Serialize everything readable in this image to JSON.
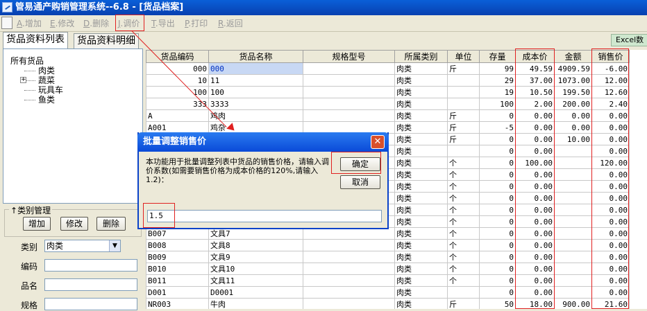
{
  "window": {
    "title": "管易通产购销管理系统--6.8 - [货品档案]"
  },
  "toolbar": {
    "items": [
      {
        "key": "A",
        "label": "增加"
      },
      {
        "key": "E",
        "label": "修改"
      },
      {
        "key": "D",
        "label": "删除"
      },
      {
        "key": "J",
        "label": "调价"
      },
      {
        "key": "T",
        "label": "导出"
      },
      {
        "key": "P",
        "label": "打印"
      },
      {
        "key": "R",
        "label": "返回"
      }
    ]
  },
  "tabs": [
    "货品资料列表",
    "货品资料明细"
  ],
  "excel_label": "Excel数",
  "tree": {
    "root": "所有货品",
    "children": [
      "肉类",
      "蔬菜",
      "玩具车",
      "鱼类"
    ]
  },
  "category_mgmt": {
    "legend": "类别管理",
    "add": "增加",
    "edit": "修改",
    "delete": "删除"
  },
  "form": {
    "category_label": "类别",
    "category_value": "肉类",
    "code_label": "编码",
    "name_label": "品名",
    "spec_label": "规格"
  },
  "table": {
    "headers": [
      "货品编码",
      "货品名称",
      "规格型号",
      "所属类别",
      "单位",
      "存量",
      "成本价",
      "金额",
      "销售价"
    ],
    "rows": [
      [
        "000",
        "000",
        "",
        "肉类",
        "斤",
        "99",
        "49.59",
        "4909.59",
        "-6.00"
      ],
      [
        "10",
        "11",
        "",
        "肉类",
        "",
        "29",
        "37.00",
        "1073.00",
        "12.00"
      ],
      [
        "100",
        "100",
        "",
        "肉类",
        "",
        "19",
        "10.50",
        "199.50",
        "12.60"
      ],
      [
        "333",
        "3333",
        "",
        "肉类",
        "",
        "100",
        "2.00",
        "200.00",
        "2.40"
      ],
      [
        "A",
        "鸡肉",
        "",
        "肉类",
        "斤",
        "0",
        "0.00",
        "0.00",
        "0.00"
      ],
      [
        "A001",
        "鸡杂",
        "",
        "肉类",
        "斤",
        "-5",
        "0.00",
        "0.00",
        "0.00"
      ],
      [
        "",
        "",
        "",
        "肉类",
        "斤",
        "0",
        "0.00",
        "10.00",
        "0.00"
      ],
      [
        "",
        "",
        "",
        "肉类",
        "",
        "0",
        "0.00",
        "",
        "0.00"
      ],
      [
        "",
        "",
        "",
        "肉类",
        "个",
        "0",
        "100.00",
        "",
        "120.00"
      ],
      [
        "",
        "",
        "",
        "肉类",
        "个",
        "0",
        "0.00",
        "",
        "0.00"
      ],
      [
        "",
        "",
        "",
        "肉类",
        "个",
        "0",
        "0.00",
        "",
        "0.00"
      ],
      [
        "",
        "",
        "",
        "肉类",
        "个",
        "0",
        "0.00",
        "",
        "0.00"
      ],
      [
        "",
        "",
        "",
        "肉类",
        "个",
        "0",
        "0.00",
        "",
        "0.00"
      ],
      [
        "",
        "",
        "",
        "肉类",
        "个",
        "0",
        "0.00",
        "",
        "0.00"
      ],
      [
        "B007",
        "文具7",
        "",
        "肉类",
        "个",
        "0",
        "0.00",
        "",
        "0.00"
      ],
      [
        "B008",
        "文具8",
        "",
        "肉类",
        "个",
        "0",
        "0.00",
        "",
        "0.00"
      ],
      [
        "B009",
        "文具9",
        "",
        "肉类",
        "个",
        "0",
        "0.00",
        "",
        "0.00"
      ],
      [
        "B010",
        "文具10",
        "",
        "肉类",
        "个",
        "0",
        "0.00",
        "",
        "0.00"
      ],
      [
        "B011",
        "文具11",
        "",
        "肉类",
        "个",
        "0",
        "0.00",
        "",
        "0.00"
      ],
      [
        "D001",
        "D0001",
        "",
        "肉类",
        "",
        "0",
        "0.00",
        "",
        "0.00"
      ],
      [
        "NR003",
        "牛肉",
        "",
        "肉类",
        "斤",
        "50",
        "18.00",
        "900.00",
        "21.60"
      ]
    ]
  },
  "dialog": {
    "title": "批量调整销售价",
    "message": "本功能用于批量调整列表中货品的销售价格，请输入调价系数(如需要销售价格为成本价格的120%,请输入1.2)：",
    "ok": "确定",
    "cancel": "取消",
    "close": "✕",
    "input_value": "1.5"
  },
  "colors": {
    "highlight": "#e02020",
    "titlebar": "#0a4ad8"
  }
}
